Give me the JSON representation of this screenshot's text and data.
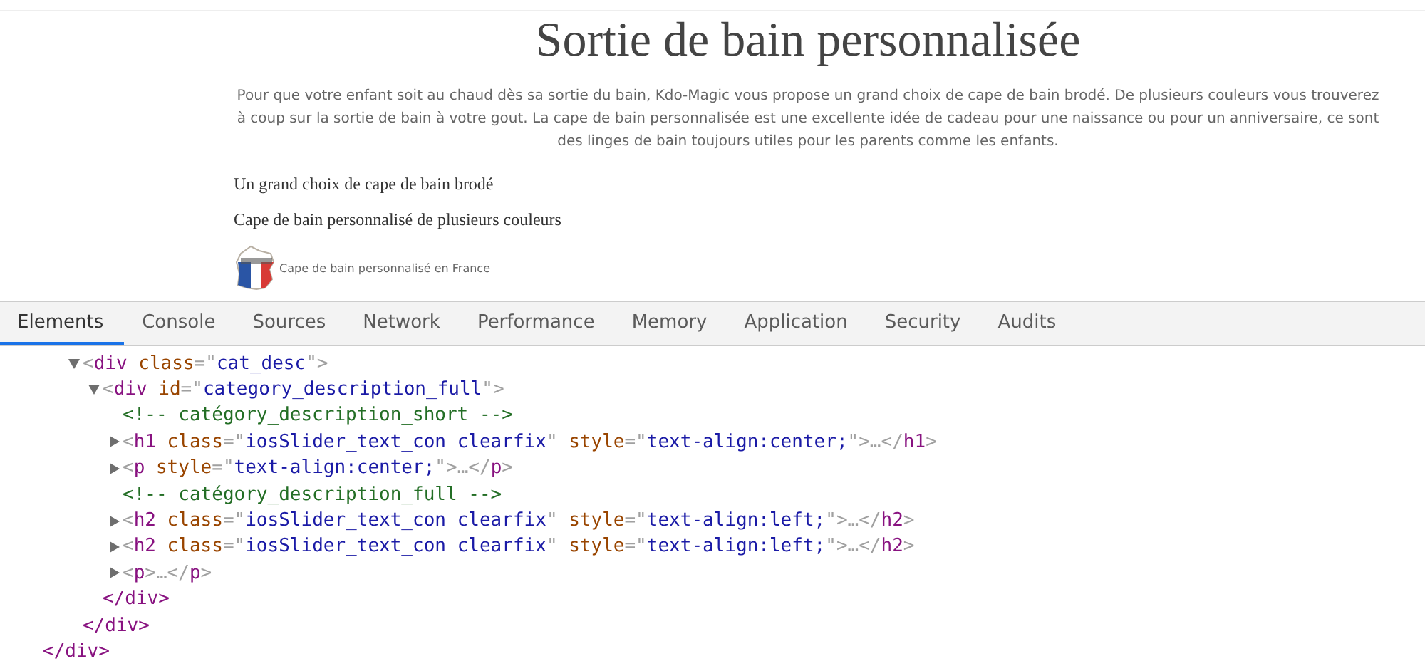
{
  "page": {
    "title": "Sortie de bain personnalisée",
    "intro": "Pour que votre enfant soit au chaud dès sa sortie du bain, Kdo-Magic vous propose un grand choix de cape de bain brodé. De plusieurs couleurs vous trouverez à coup sur la sortie de bain à votre gout. La cape de bain personnalisée est une excellente idée de cadeau pour une naissance ou pour un anniversaire, ce sont des linges de bain toujours utiles pour les parents comme les enfants.",
    "subheadings": [
      "Un grand choix de cape de bain brodé",
      "Cape de bain personnalisé de plusieurs couleurs"
    ],
    "badge_caption": "Cape de bain personnalisé en France"
  },
  "devtools": {
    "tabs": [
      {
        "label": "Elements",
        "selected": true
      },
      {
        "label": "Console",
        "selected": false
      },
      {
        "label": "Sources",
        "selected": false
      },
      {
        "label": "Network",
        "selected": false
      },
      {
        "label": "Performance",
        "selected": false
      },
      {
        "label": "Memory",
        "selected": false
      },
      {
        "label": "Application",
        "selected": false
      },
      {
        "label": "Security",
        "selected": false
      },
      {
        "label": "Audits",
        "selected": false
      }
    ],
    "tree": [
      {
        "kind": "element",
        "expanded": true,
        "parts": [
          {
            "kind": "punct",
            "text": "<"
          },
          {
            "kind": "tag",
            "text": "div"
          },
          {
            "kind": "attr",
            "text": " class"
          },
          {
            "kind": "punct",
            "text": "=\""
          },
          {
            "kind": "value",
            "text": "cat_desc"
          },
          {
            "kind": "punct",
            "text": "\">"
          }
        ],
        "close": "</div>",
        "children": [
          {
            "kind": "element",
            "expanded": true,
            "parts": [
              {
                "kind": "punct",
                "text": "<"
              },
              {
                "kind": "tag",
                "text": "div"
              },
              {
                "kind": "attr",
                "text": " id"
              },
              {
                "kind": "punct",
                "text": "=\""
              },
              {
                "kind": "value",
                "text": "category_description_full"
              },
              {
                "kind": "punct",
                "text": "\">"
              }
            ],
            "close": "</div>",
            "children": [
              {
                "kind": "comment",
                "text": "<!-- catégory_description_short -->"
              },
              {
                "kind": "element",
                "expanded": false,
                "parts": [
                  {
                    "kind": "punct",
                    "text": "<"
                  },
                  {
                    "kind": "tag",
                    "text": "h1"
                  },
                  {
                    "kind": "attr",
                    "text": " class"
                  },
                  {
                    "kind": "punct",
                    "text": "=\""
                  },
                  {
                    "kind": "value",
                    "text": "iosSlider_text_con clearfix"
                  },
                  {
                    "kind": "punct",
                    "text": "\""
                  },
                  {
                    "kind": "attr",
                    "text": " style"
                  },
                  {
                    "kind": "punct",
                    "text": "=\""
                  },
                  {
                    "kind": "value",
                    "text": "text-align:center;"
                  },
                  {
                    "kind": "punct",
                    "text": "\">…</"
                  },
                  {
                    "kind": "tag",
                    "text": "h1"
                  },
                  {
                    "kind": "punct",
                    "text": ">"
                  }
                ]
              },
              {
                "kind": "element",
                "expanded": false,
                "parts": [
                  {
                    "kind": "punct",
                    "text": "<"
                  },
                  {
                    "kind": "tag",
                    "text": "p"
                  },
                  {
                    "kind": "attr",
                    "text": " style"
                  },
                  {
                    "kind": "punct",
                    "text": "=\""
                  },
                  {
                    "kind": "value",
                    "text": "text-align:center;"
                  },
                  {
                    "kind": "punct",
                    "text": "\">…</"
                  },
                  {
                    "kind": "tag",
                    "text": "p"
                  },
                  {
                    "kind": "punct",
                    "text": ">"
                  }
                ]
              },
              {
                "kind": "comment",
                "text": "<!-- catégory_description_full -->"
              },
              {
                "kind": "element",
                "expanded": false,
                "parts": [
                  {
                    "kind": "punct",
                    "text": "<"
                  },
                  {
                    "kind": "tag",
                    "text": "h2"
                  },
                  {
                    "kind": "attr",
                    "text": " class"
                  },
                  {
                    "kind": "punct",
                    "text": "=\""
                  },
                  {
                    "kind": "value",
                    "text": "iosSlider_text_con clearfix"
                  },
                  {
                    "kind": "punct",
                    "text": "\""
                  },
                  {
                    "kind": "attr",
                    "text": " style"
                  },
                  {
                    "kind": "punct",
                    "text": "=\""
                  },
                  {
                    "kind": "value",
                    "text": "text-align:left;"
                  },
                  {
                    "kind": "punct",
                    "text": "\">…</"
                  },
                  {
                    "kind": "tag",
                    "text": "h2"
                  },
                  {
                    "kind": "punct",
                    "text": ">"
                  }
                ]
              },
              {
                "kind": "element",
                "expanded": false,
                "parts": [
                  {
                    "kind": "punct",
                    "text": "<"
                  },
                  {
                    "kind": "tag",
                    "text": "h2"
                  },
                  {
                    "kind": "attr",
                    "text": " class"
                  },
                  {
                    "kind": "punct",
                    "text": "=\""
                  },
                  {
                    "kind": "value",
                    "text": "iosSlider_text_con clearfix"
                  },
                  {
                    "kind": "punct",
                    "text": "\""
                  },
                  {
                    "kind": "attr",
                    "text": " style"
                  },
                  {
                    "kind": "punct",
                    "text": "=\""
                  },
                  {
                    "kind": "value",
                    "text": "text-align:left;"
                  },
                  {
                    "kind": "punct",
                    "text": "\">…</"
                  },
                  {
                    "kind": "tag",
                    "text": "h2"
                  },
                  {
                    "kind": "punct",
                    "text": ">"
                  }
                ]
              },
              {
                "kind": "element",
                "expanded": false,
                "parts": [
                  {
                    "kind": "punct",
                    "text": "<"
                  },
                  {
                    "kind": "tag",
                    "text": "p"
                  },
                  {
                    "kind": "punct",
                    "text": ">…</"
                  },
                  {
                    "kind": "tag",
                    "text": "p"
                  },
                  {
                    "kind": "punct",
                    "text": ">"
                  }
                ]
              }
            ]
          }
        ]
      }
    ],
    "outer_close": "</div>"
  }
}
